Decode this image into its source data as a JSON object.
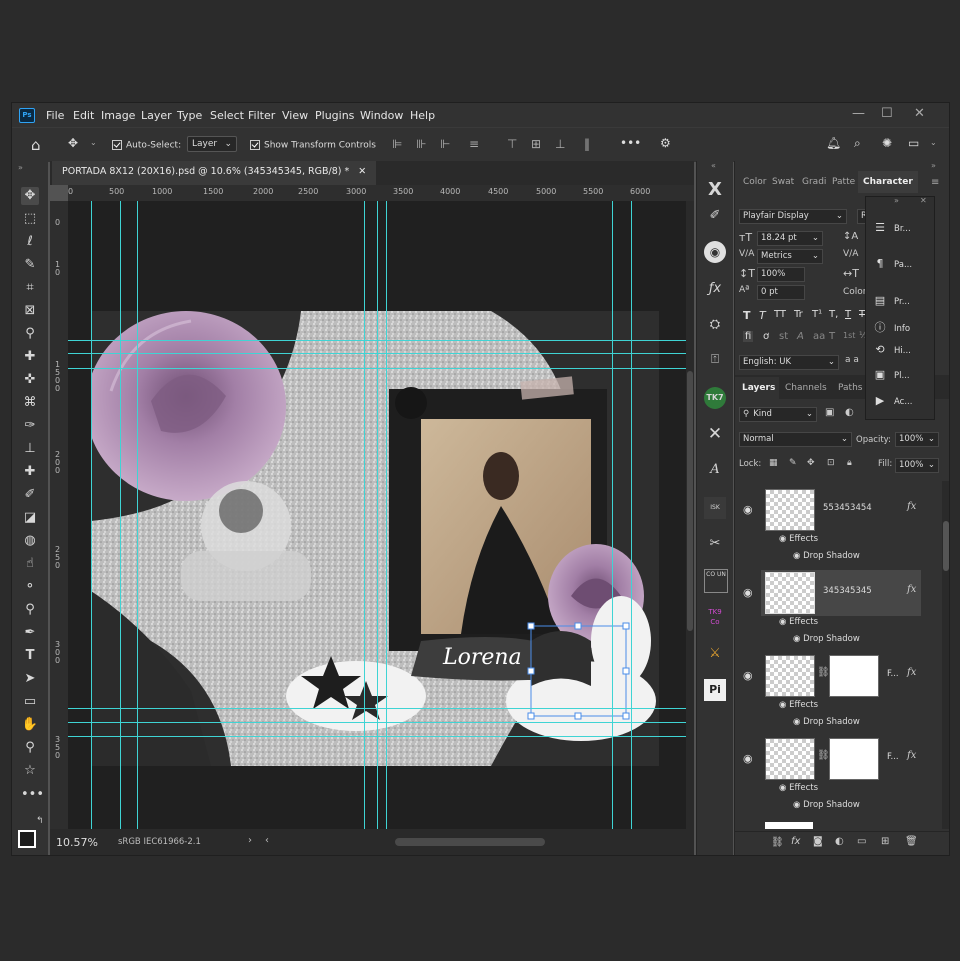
{
  "menubar": {
    "app_icon": "Ps",
    "items": [
      "File",
      "Edit",
      "Image",
      "Layer",
      "Type",
      "Select",
      "Filter",
      "View",
      "Plugins",
      "Window",
      "Help"
    ]
  },
  "options": {
    "auto_select_label": "Auto-Select:",
    "auto_select_value": "Layer",
    "show_transform_label": "Show Transform Controls",
    "more_label": "•••"
  },
  "document": {
    "tab_title": "PORTADA 8X12 (20X16).psd @ 10.6% (345345345, RGB/8) *",
    "ruler_h": [
      "0",
      "500",
      "1000",
      "1500",
      "2000",
      "2500",
      "3000",
      "3500",
      "4000",
      "4500",
      "5000",
      "5500",
      "6000"
    ],
    "ruler_v": [
      "0",
      "1",
      "0",
      "1",
      "5",
      "0",
      "0",
      "2",
      "0",
      "0",
      "2",
      "5",
      "0",
      "3",
      "0",
      "0",
      "3",
      "5",
      "0",
      "4",
      "0"
    ],
    "zoom": "10.57%",
    "profile": "sRGB IEC61966-2.1",
    "canvas_text": "Lorena"
  },
  "colors": {
    "accent_guides": "#3fd4d4",
    "panel_bg": "#323232",
    "ui_bg": "#535353"
  },
  "top_tabs": [
    "Color",
    "Swat",
    "Gradi",
    "Patte",
    "Character"
  ],
  "character": {
    "font": "Playfair Display",
    "style_short": "R",
    "size": "18.24 pt",
    "kerning": "Metrics",
    "scale": "100%",
    "baseline": "0 pt",
    "color_label": "Color:",
    "language": "English: UK",
    "aa_glyph": "a a",
    "type_buttons": [
      "T",
      "T",
      "TT",
      "Tr",
      "T¹",
      "T,",
      "T",
      "T"
    ],
    "glyph_buttons": [
      "fi",
      "ơ",
      "st",
      "A",
      "aa",
      "T",
      "1st",
      "½"
    ]
  },
  "flyout": {
    "items": [
      {
        "icon": "brush-settings-icon",
        "glyph": "☰",
        "label": "Br..."
      },
      {
        "icon": "paragraph-icon",
        "glyph": "¶",
        "label": "Pa..."
      },
      {
        "icon": "properties-icon",
        "glyph": "▤",
        "label": "Pr..."
      },
      {
        "icon": "info-icon",
        "glyph": "ⓘ",
        "label": "Info"
      },
      {
        "icon": "history-icon",
        "glyph": "⟲",
        "label": "Hi..."
      },
      {
        "icon": "plugins-icon",
        "glyph": "▣",
        "label": "Pl..."
      },
      {
        "icon": "actions-icon",
        "glyph": "▶",
        "label": "Ac..."
      }
    ]
  },
  "layers": {
    "tabs": [
      "Layers",
      "Channels",
      "Paths"
    ],
    "filter_label": "Kind",
    "blend_mode": "Normal",
    "opacity_label": "Opacity:",
    "opacity_value": "100%",
    "lock_label": "Lock:",
    "fill_label": "Fill:",
    "fill_value": "100%",
    "effects_label": "Effects",
    "drop_shadow_label": "Drop Shadow",
    "rows": [
      {
        "name": "553453454",
        "fx": "fx"
      },
      {
        "name": "345345345",
        "fx": "fx"
      },
      {
        "name": "F...",
        "fx": "fx"
      },
      {
        "name": "F...",
        "fx": "fx"
      }
    ]
  },
  "icon_strip": [
    "X",
    "✐",
    "◉",
    "ƒx",
    "⛭",
    "⍐",
    "TK7",
    "✕",
    "A",
    "ISK",
    "✂",
    "CO UN",
    "TK9 Co",
    "⚔",
    "Pi"
  ]
}
